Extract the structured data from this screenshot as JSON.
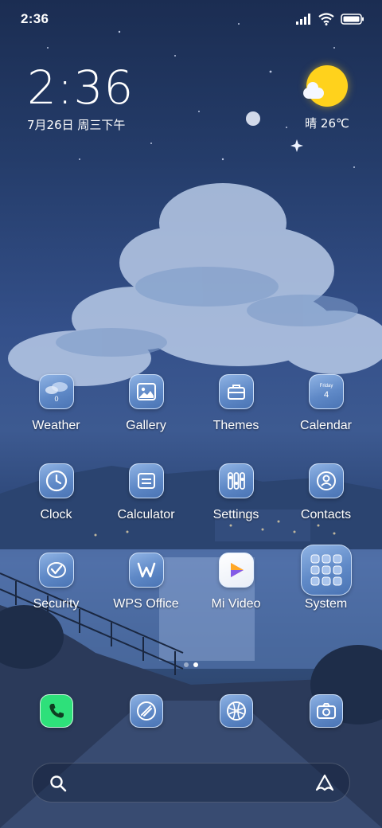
{
  "status_bar": {
    "time": "2:36",
    "icons": [
      "signal-icon",
      "wifi-icon",
      "battery-icon"
    ]
  },
  "clock_widget": {
    "time": "2:36",
    "date": "7月26日 周三下午"
  },
  "weather_widget": {
    "icon": "partly-sunny-icon",
    "text": "晴 26℃"
  },
  "apps": [
    {
      "label": "Weather",
      "icon": "weather-icon",
      "badge": "0"
    },
    {
      "label": "Gallery",
      "icon": "gallery-icon"
    },
    {
      "label": "Themes",
      "icon": "themes-icon"
    },
    {
      "label": "Calendar",
      "icon": "calendar-icon",
      "day_name": "Friday",
      "day_number": "4"
    },
    {
      "label": "Clock",
      "icon": "clock-icon"
    },
    {
      "label": "Calculator",
      "icon": "calculator-icon"
    },
    {
      "label": "Settings",
      "icon": "settings-icon"
    },
    {
      "label": "Contacts",
      "icon": "contacts-icon"
    },
    {
      "label": "Security",
      "icon": "security-icon"
    },
    {
      "label": "WPS Office",
      "icon": "wps-office-icon"
    },
    {
      "label": "Mi Video",
      "icon": "mi-video-icon"
    },
    {
      "label": "System",
      "icon": "system-folder-icon"
    }
  ],
  "page_indicator": {
    "pages": 2,
    "active": 2
  },
  "dock": [
    {
      "icon": "phone-icon"
    },
    {
      "icon": "messages-icon"
    },
    {
      "icon": "browser-icon"
    },
    {
      "icon": "camera-icon"
    }
  ],
  "search_bar": {
    "left_icon": "search-icon",
    "right_icon": "assistant-icon"
  },
  "colors": {
    "sky_top": "#1b2d52",
    "sky_mid": "#3d5a91",
    "icon_blue": "#5f89c7",
    "sun_yellow": "#ffd21c",
    "phone_green": "#2ee07a"
  }
}
